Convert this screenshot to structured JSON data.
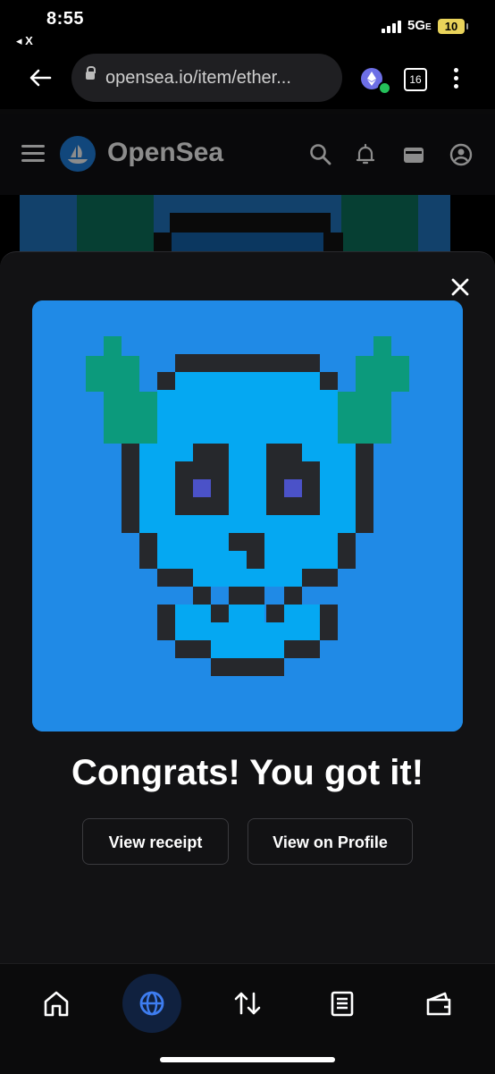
{
  "status_bar": {
    "time": "8:55",
    "back_app": "◂ X",
    "network": "5G",
    "network_suffix": "E",
    "battery": "10"
  },
  "browser": {
    "url": "opensea.io/item/ether...",
    "tab_count": "16"
  },
  "site_header": {
    "brand": "OpenSea"
  },
  "modal": {
    "title": "Congrats! You got it!",
    "view_receipt_label": "View receipt",
    "view_profile_label": "View on Profile"
  },
  "bottom_nav": {
    "items": [
      "home-icon",
      "globe-icon",
      "swap-icon",
      "list-icon",
      "wallet-icon"
    ],
    "active_index": 1
  },
  "colors": {
    "accent": "#2081e2",
    "art_background": "#208ae6",
    "skull_fill": "#05a8f2",
    "skull_outline": "#26282c",
    "horn_green": "#0c9a7c",
    "eye_purple": "#4b52c8"
  }
}
